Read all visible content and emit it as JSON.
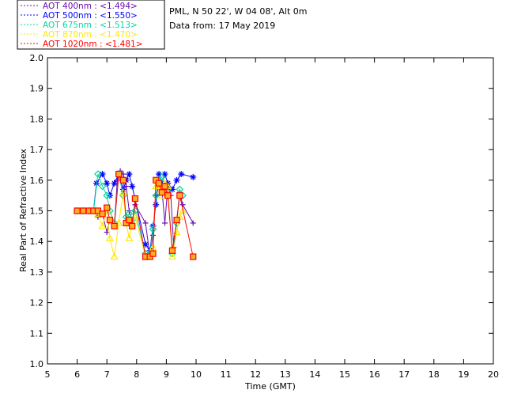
{
  "chart_data": {
    "type": "line",
    "title": "",
    "info_lines": [
      "PML, N 50 22', W 04 08', Alt 0m",
      "Data from: 17 May 2019"
    ],
    "xlabel": "Time (GMT)",
    "ylabel": "Real Part of Refractive Index",
    "xlim": [
      5,
      20
    ],
    "ylim": [
      1.0,
      2.0
    ],
    "xticks": [
      "5",
      "6",
      "7",
      "8",
      "9",
      "10",
      "11",
      "12",
      "13",
      "14",
      "15",
      "16",
      "17",
      "18",
      "19",
      "20"
    ],
    "yticks": [
      "1.0",
      "1.1",
      "1.2",
      "1.3",
      "1.4",
      "1.5",
      "1.6",
      "1.7",
      "1.8",
      "1.9",
      "2.0"
    ],
    "grid": false,
    "legend_position": "top-left",
    "series": [
      {
        "name": "AOT  400nm : <1.494>",
        "color": "#6a0dad",
        "marker": "plus",
        "points": [
          [
            6.0,
            1.5
          ],
          [
            6.2,
            1.5
          ],
          [
            6.4,
            1.5
          ],
          [
            6.55,
            1.5
          ],
          [
            6.7,
            1.48
          ],
          [
            6.85,
            1.49
          ],
          [
            7.0,
            1.43
          ],
          [
            7.1,
            1.47
          ],
          [
            7.25,
            1.45
          ],
          [
            7.35,
            1.6
          ],
          [
            7.45,
            1.63
          ],
          [
            7.55,
            1.62
          ],
          [
            7.65,
            1.58
          ],
          [
            7.75,
            1.5
          ],
          [
            7.85,
            1.46
          ],
          [
            7.95,
            1.52
          ],
          [
            8.3,
            1.46
          ],
          [
            8.45,
            1.35
          ],
          [
            8.55,
            1.42
          ],
          [
            8.65,
            1.55
          ],
          [
            8.75,
            1.58
          ],
          [
            8.85,
            1.57
          ],
          [
            8.95,
            1.46
          ],
          [
            9.05,
            1.58
          ],
          [
            9.15,
            1.55
          ],
          [
            9.25,
            1.38
          ],
          [
            9.35,
            1.47
          ],
          [
            9.45,
            1.56
          ],
          [
            9.55,
            1.52
          ],
          [
            9.9,
            1.46
          ]
        ]
      },
      {
        "name": "AOT  500nm : <1.550>",
        "color": "#0000ff",
        "marker": "asterisk",
        "points": [
          [
            6.0,
            1.5
          ],
          [
            6.2,
            1.5
          ],
          [
            6.4,
            1.5
          ],
          [
            6.55,
            1.5
          ],
          [
            6.65,
            1.59
          ],
          [
            6.85,
            1.62
          ],
          [
            7.0,
            1.59
          ],
          [
            7.1,
            1.55
          ],
          [
            7.25,
            1.59
          ],
          [
            7.4,
            1.62
          ],
          [
            7.55,
            1.57
          ],
          [
            7.65,
            1.6
          ],
          [
            7.75,
            1.62
          ],
          [
            7.85,
            1.58
          ],
          [
            8.3,
            1.39
          ],
          [
            8.45,
            1.37
          ],
          [
            8.55,
            1.45
          ],
          [
            8.65,
            1.52
          ],
          [
            8.75,
            1.62
          ],
          [
            8.85,
            1.59
          ],
          [
            8.95,
            1.62
          ],
          [
            9.05,
            1.59
          ],
          [
            9.2,
            1.57
          ],
          [
            9.35,
            1.6
          ],
          [
            9.5,
            1.62
          ],
          [
            9.9,
            1.61
          ]
        ]
      },
      {
        "name": "AOT  675nm : <1.513>",
        "color": "#00d8a0",
        "marker": "diamond",
        "points": [
          [
            6.0,
            1.5
          ],
          [
            6.2,
            1.5
          ],
          [
            6.4,
            1.5
          ],
          [
            6.55,
            1.5
          ],
          [
            6.7,
            1.62
          ],
          [
            6.85,
            1.58
          ],
          [
            7.0,
            1.55
          ],
          [
            7.1,
            1.5
          ],
          [
            7.25,
            1.46
          ],
          [
            7.4,
            1.62
          ],
          [
            7.55,
            1.55
          ],
          [
            7.65,
            1.48
          ],
          [
            7.75,
            1.49
          ],
          [
            7.85,
            1.47
          ],
          [
            7.95,
            1.5
          ],
          [
            8.3,
            1.36
          ],
          [
            8.45,
            1.36
          ],
          [
            8.55,
            1.44
          ],
          [
            8.65,
            1.55
          ],
          [
            8.75,
            1.6
          ],
          [
            8.85,
            1.61
          ],
          [
            8.95,
            1.57
          ],
          [
            9.05,
            1.57
          ],
          [
            9.2,
            1.36
          ],
          [
            9.35,
            1.46
          ],
          [
            9.45,
            1.57
          ],
          [
            9.55,
            1.55
          ]
        ]
      },
      {
        "name": "AOT  870nm : <1.470>",
        "color": "#ffe800",
        "marker": "triangle",
        "points": [
          [
            6.0,
            1.5
          ],
          [
            6.2,
            1.5
          ],
          [
            6.4,
            1.5
          ],
          [
            6.55,
            1.5
          ],
          [
            6.7,
            1.49
          ],
          [
            6.85,
            1.45
          ],
          [
            7.0,
            1.5
          ],
          [
            7.1,
            1.41
          ],
          [
            7.25,
            1.35
          ],
          [
            7.4,
            1.46
          ],
          [
            7.55,
            1.56
          ],
          [
            7.65,
            1.46
          ],
          [
            7.75,
            1.41
          ],
          [
            7.85,
            1.46
          ],
          [
            7.95,
            1.48
          ],
          [
            8.3,
            1.35
          ],
          [
            8.45,
            1.35
          ],
          [
            8.55,
            1.38
          ],
          [
            8.65,
            1.58
          ],
          [
            8.75,
            1.58
          ],
          [
            8.85,
            1.55
          ],
          [
            8.95,
            1.59
          ],
          [
            9.05,
            1.58
          ],
          [
            9.2,
            1.35
          ],
          [
            9.35,
            1.43
          ],
          [
            9.45,
            1.48
          ],
          [
            9.55,
            1.5
          ]
        ]
      },
      {
        "name": "AOT 1020nm : <1.481>",
        "color": "#ff0000",
        "marker": "square",
        "points": [
          [
            6.0,
            1.5
          ],
          [
            6.2,
            1.5
          ],
          [
            6.4,
            1.5
          ],
          [
            6.55,
            1.5
          ],
          [
            6.7,
            1.5
          ],
          [
            6.85,
            1.49
          ],
          [
            7.0,
            1.51
          ],
          [
            7.1,
            1.47
          ],
          [
            7.25,
            1.45
          ],
          [
            7.4,
            1.62
          ],
          [
            7.55,
            1.6
          ],
          [
            7.65,
            1.46
          ],
          [
            7.75,
            1.47
          ],
          [
            7.85,
            1.45
          ],
          [
            7.95,
            1.54
          ],
          [
            8.3,
            1.35
          ],
          [
            8.45,
            1.35
          ],
          [
            8.55,
            1.36
          ],
          [
            8.65,
            1.6
          ],
          [
            8.75,
            1.59
          ],
          [
            8.85,
            1.56
          ],
          [
            8.95,
            1.58
          ],
          [
            9.05,
            1.55
          ],
          [
            9.2,
            1.37
          ],
          [
            9.35,
            1.47
          ],
          [
            9.45,
            1.55
          ],
          [
            9.9,
            1.35
          ]
        ]
      }
    ]
  }
}
